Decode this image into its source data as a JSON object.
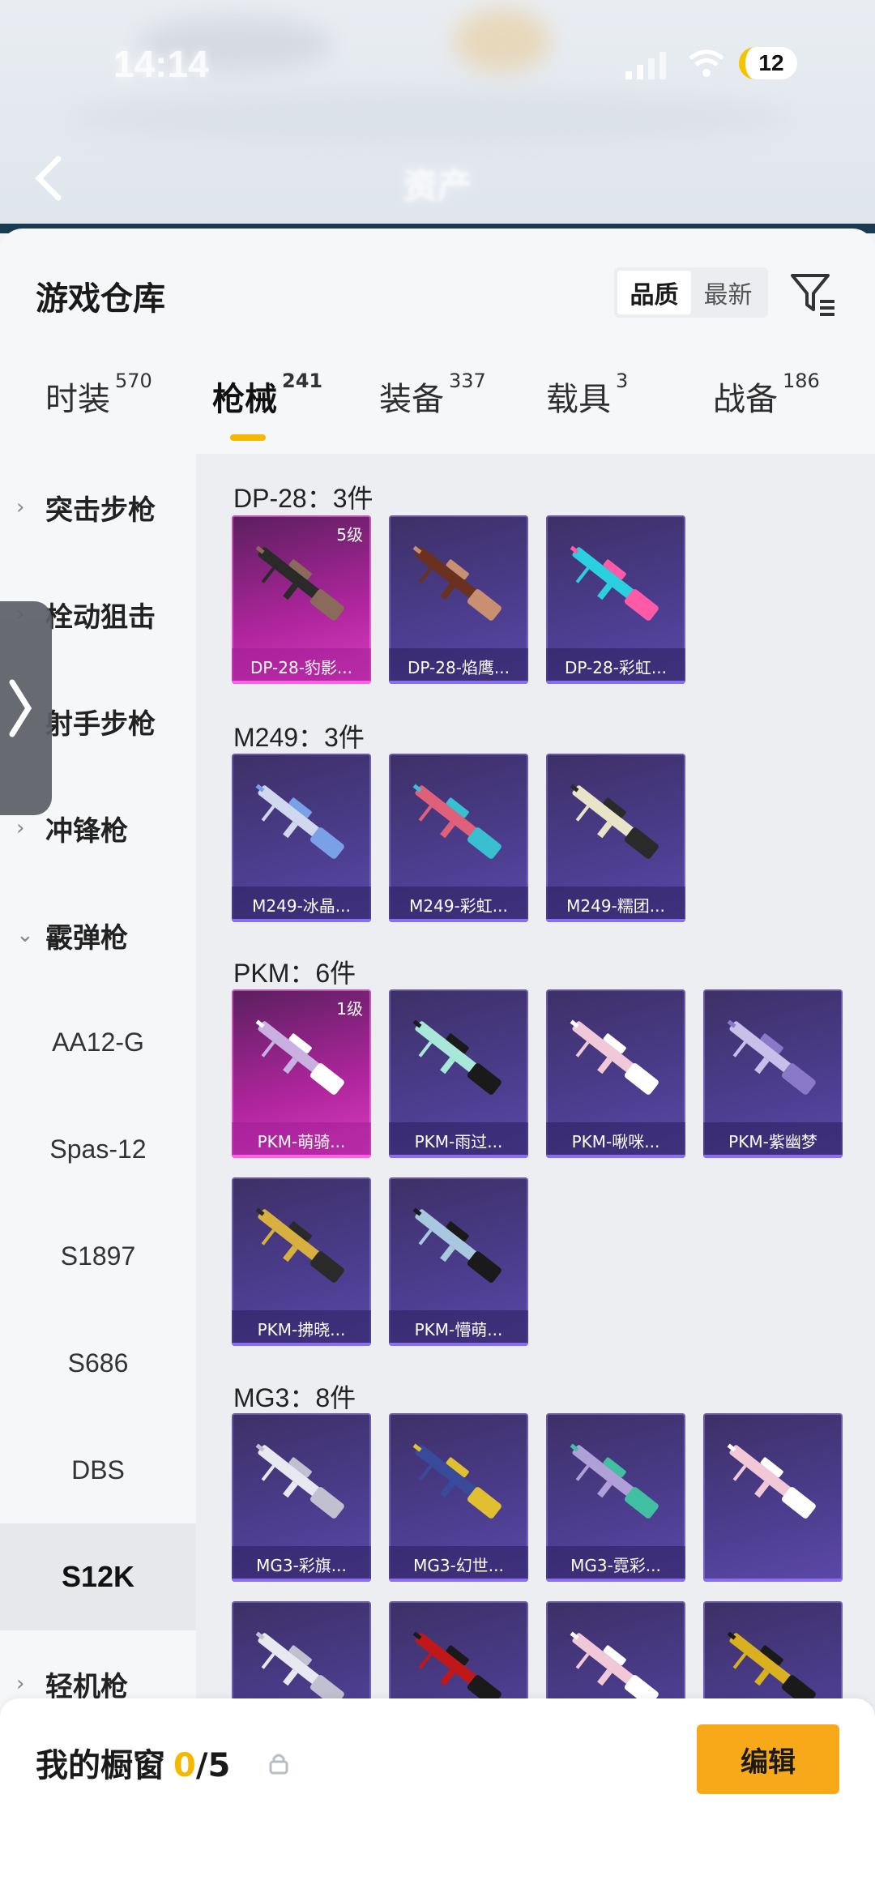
{
  "status_bar": {
    "time": "14:14",
    "battery": "12"
  },
  "header": {
    "title": "资产"
  },
  "panel": {
    "title": "游戏仓库",
    "sort": {
      "quality_label": "品质",
      "newest_label": "最新",
      "selected": "品质"
    }
  },
  "tabs": [
    {
      "label": "时装",
      "count": "570"
    },
    {
      "label": "枪械",
      "count": "241"
    },
    {
      "label": "装备",
      "count": "337"
    },
    {
      "label": "载具",
      "count": "3"
    },
    {
      "label": "战备",
      "count": "186"
    }
  ],
  "sidebar": {
    "groups": [
      {
        "label": "突击步枪",
        "chev": "›"
      },
      {
        "label": "栓动狙击",
        "chev": "›"
      },
      {
        "label": "射手步枪",
        "chev": "›"
      },
      {
        "label": "冲锋枪",
        "chev": "›"
      },
      {
        "label": "霰弹枪",
        "chev": "⌄"
      }
    ],
    "sub_items": [
      "AA12-G",
      "Spas-12",
      "S1897",
      "S686",
      "DBS",
      "S12K"
    ],
    "selected_sub": "S12K",
    "last_group": {
      "label": "轻机枪",
      "chev": "›"
    }
  },
  "groups": [
    {
      "title": "DP-28：3件",
      "cards": [
        {
          "label": "DP-28-豹影...",
          "level": "5级",
          "rarity": "pink"
        },
        {
          "label": "DP-28-焰鹰...",
          "level": "",
          "rarity": "purple"
        },
        {
          "label": "DP-28-彩虹...",
          "level": "",
          "rarity": "purple"
        }
      ]
    },
    {
      "title": "M249：3件",
      "cards": [
        {
          "label": "M249-冰晶...",
          "level": "",
          "rarity": "purple"
        },
        {
          "label": "M249-彩虹...",
          "level": "",
          "rarity": "purple"
        },
        {
          "label": "M249-糯团...",
          "level": "",
          "rarity": "purple"
        }
      ]
    },
    {
      "title": "PKM：6件",
      "cards": [
        {
          "label": "PKM-萌骑...",
          "level": "1级",
          "rarity": "pink"
        },
        {
          "label": "PKM-雨过...",
          "level": "",
          "rarity": "purple"
        },
        {
          "label": "PKM-啾咪...",
          "level": "",
          "rarity": "purple"
        },
        {
          "label": "PKM-紫幽梦",
          "level": "",
          "rarity": "purple"
        },
        {
          "label": "PKM-拂晓...",
          "level": "",
          "rarity": "purple"
        },
        {
          "label": "PKM-懵萌...",
          "level": "",
          "rarity": "purple"
        }
      ]
    },
    {
      "title": "MG3：8件",
      "cards": [
        {
          "label": "MG3-彩旗...",
          "level": "",
          "rarity": "purple"
        },
        {
          "label": "MG3-幻世...",
          "level": "",
          "rarity": "purple"
        },
        {
          "label": "MG3-霓彩...",
          "level": "",
          "rarity": "purple"
        },
        {
          "label": "",
          "level": "",
          "rarity": "purple"
        },
        {
          "label": "",
          "level": "",
          "rarity": "purple"
        },
        {
          "label": "",
          "level": "",
          "rarity": "purple"
        },
        {
          "label": "",
          "level": "",
          "rarity": "purple"
        },
        {
          "label": "",
          "level": "",
          "rarity": "purple"
        }
      ]
    }
  ],
  "showcase": {
    "title": "我的橱窗",
    "current": "0",
    "total": "/5",
    "edit_label": "编辑"
  },
  "colors": {
    "accent": "#f5b700",
    "fab": "#f8b21a",
    "card_purple": "#4b3c8c",
    "card_pink": "#b0259e"
  },
  "icons": {
    "back": "back-icon",
    "filter": "filter-icon",
    "share": "share-icon",
    "lock": "lock-icon"
  }
}
